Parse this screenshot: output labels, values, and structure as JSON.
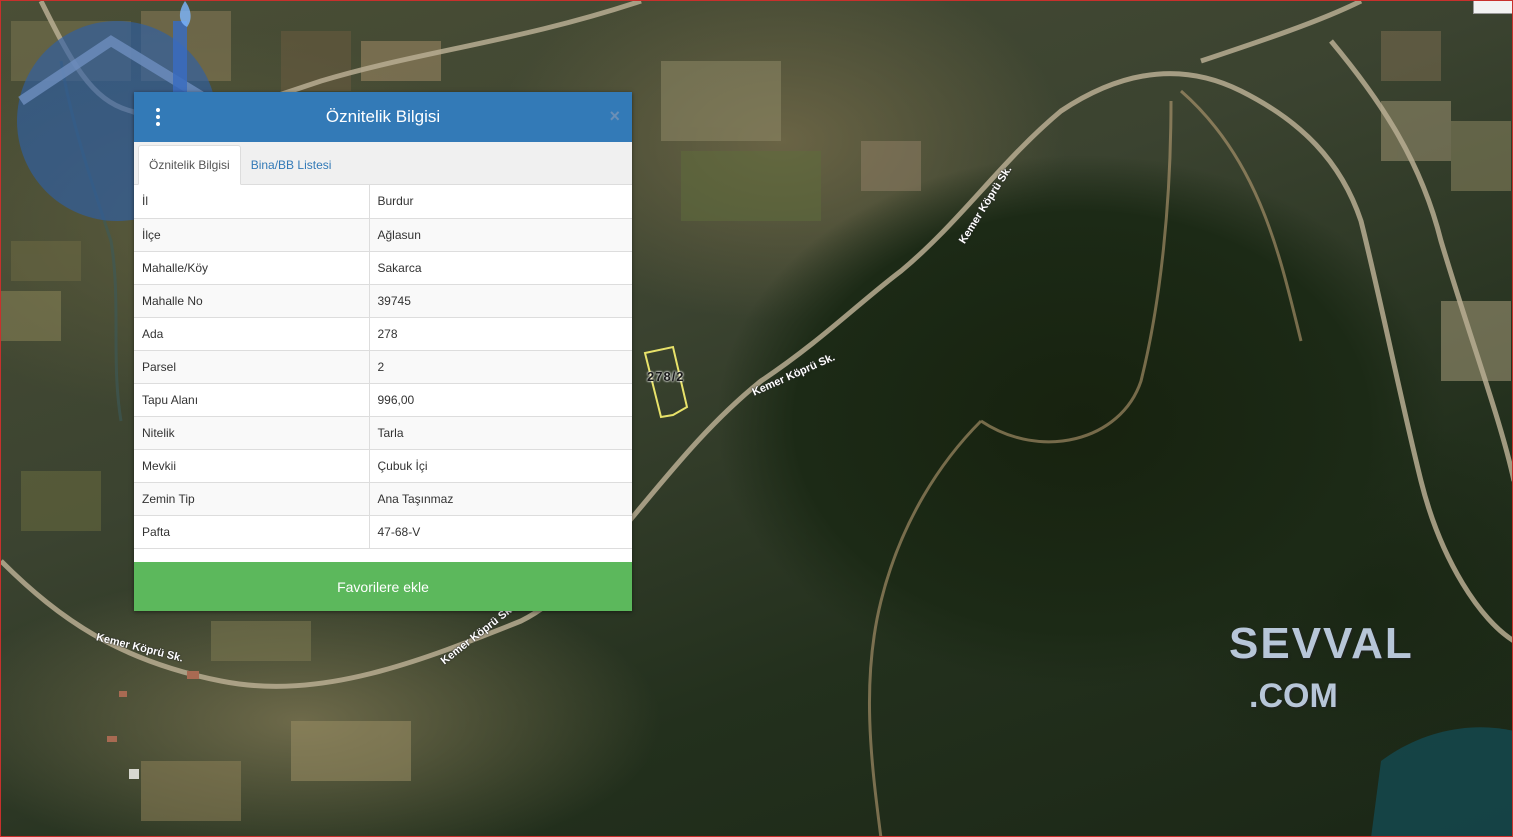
{
  "map": {
    "parcel_label": "278/2",
    "street_labels": [
      "Kemer Köprü Sk.",
      "Kemer Köprü Sk.",
      "Kemer Köprü Sk.",
      "Kemer Köprü Sk."
    ],
    "watermark_line1": "SEVVAL",
    "watermark_line2": ".COM"
  },
  "panel": {
    "title": "Öznitelik Bilgisi",
    "close_label": "×",
    "tabs": [
      {
        "label": "Öznitelik Bilgisi",
        "active": true
      },
      {
        "label": "Bina/BB Listesi",
        "active": false
      }
    ],
    "rows": [
      {
        "key": "İl",
        "value": "Burdur"
      },
      {
        "key": "İlçe",
        "value": "Ağlasun"
      },
      {
        "key": "Mahalle/Köy",
        "value": "Sakarca"
      },
      {
        "key": "Mahalle No",
        "value": "39745"
      },
      {
        "key": "Ada",
        "value": "278"
      },
      {
        "key": "Parsel",
        "value": "2"
      },
      {
        "key": "Tapu Alanı",
        "value": "996,00"
      },
      {
        "key": "Nitelik",
        "value": "Tarla"
      },
      {
        "key": "Mevkii",
        "value": "Çubuk İçi"
      },
      {
        "key": "Zemin Tip",
        "value": "Ana Taşınmaz"
      },
      {
        "key": "Pafta",
        "value": "47-68-V"
      }
    ],
    "favorite_button": "Favorilere ekle"
  },
  "colors": {
    "header": "#337ab7",
    "favorite_button": "#5cb85c",
    "parcel_outline": "#e8e26a"
  }
}
